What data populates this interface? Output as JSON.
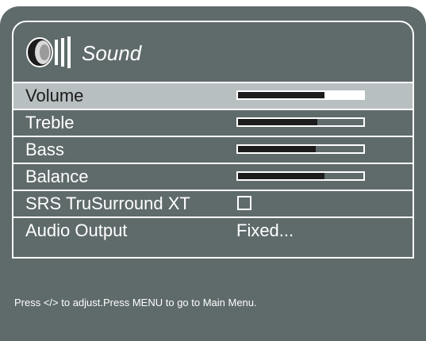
{
  "menu": {
    "title": "Sound",
    "title_icon": "speaker-icon"
  },
  "rows": [
    {
      "label": "Volume",
      "type": "slider",
      "level": 0.69,
      "selected": true
    },
    {
      "label": "Treble",
      "type": "slider",
      "level": 0.63,
      "selected": false
    },
    {
      "label": "Bass",
      "type": "slider",
      "level": 0.62,
      "selected": false
    },
    {
      "label": "Balance",
      "type": "slider",
      "level": 0.69,
      "selected": false
    },
    {
      "label": "SRS TruSurround XT",
      "type": "checkbox",
      "checked": false,
      "selected": false
    },
    {
      "label": "Audio Output",
      "type": "value",
      "value": "Fixed...",
      "selected": false
    }
  ],
  "hint": "Press </> to adjust.Press MENU to go to Main Menu.",
  "colors": {
    "background": "#5f6a6b",
    "selected_row": "#b8bfc1",
    "border": "#ffffff",
    "slider_fill": "#1c1c1c"
  }
}
